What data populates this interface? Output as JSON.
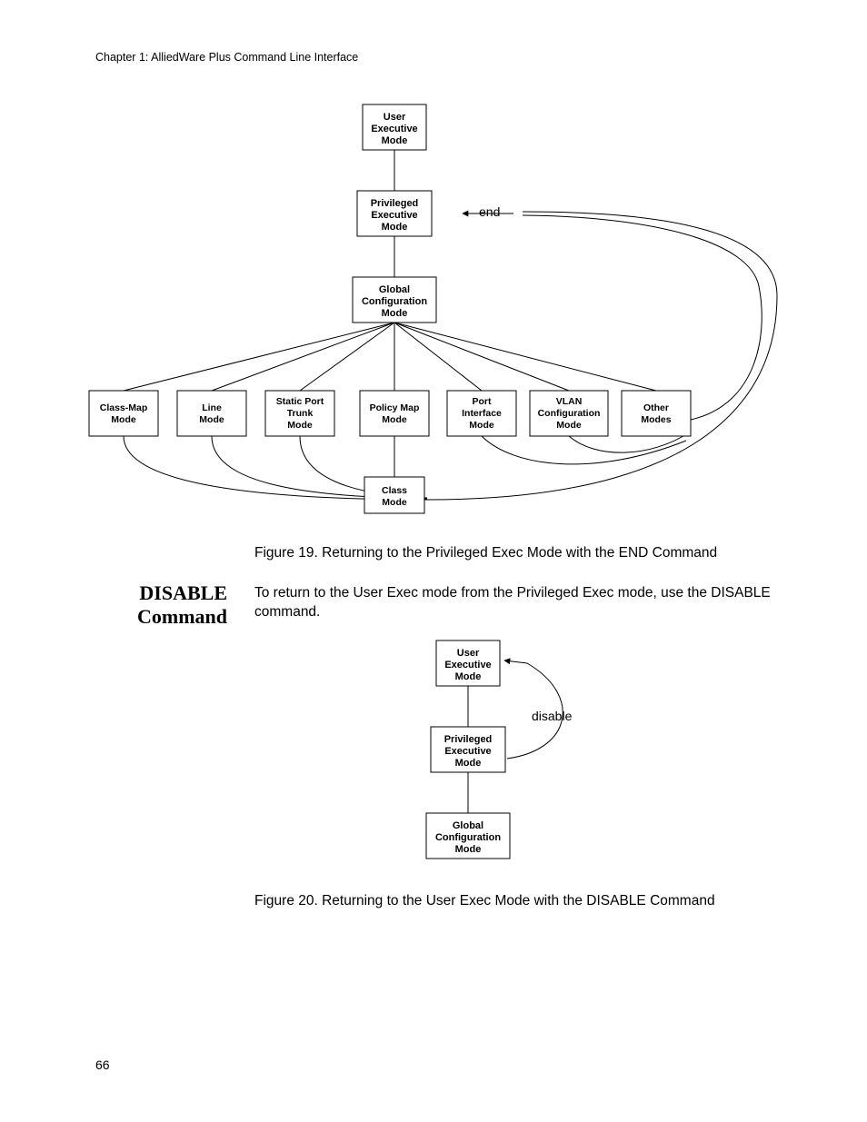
{
  "header": {
    "chapter": "Chapter 1: AlliedWare Plus Command Line Interface"
  },
  "page_number": "66",
  "figure19": {
    "caption": "Figure 19. Returning to the Privileged Exec Mode with the END Command",
    "nodes": {
      "user_exec": "User\nExecutive\nMode",
      "priv_exec": "Privileged\nExecutive\nMode",
      "global_conf": "Global\nConfiguration\nMode",
      "class_map": "Class-Map\nMode",
      "line_mode": "Line\nMode",
      "static_port": "Static Port\nTrunk\nMode",
      "policy_map": "Policy Map\nMode",
      "port_iface": "Port\nInterface\nMode",
      "vlan_conf": "VLAN\nConfiguration\nMode",
      "other_modes": "Other\nModes",
      "class_mode": "Class\nMode"
    },
    "end_label": "end"
  },
  "section": {
    "title_line1": "DISABLE",
    "title_line2": "Command",
    "body": "To return to the User Exec mode from the Privileged Exec mode, use the DISABLE command."
  },
  "figure20": {
    "caption": "Figure 20. Returning to the User Exec Mode with the DISABLE Command",
    "nodes": {
      "user_exec": "User\nExecutive\nMode",
      "priv_exec": "Privileged\nExecutive\nMode",
      "global_conf": "Global\nConfiguration\nMode"
    },
    "disable_label": "disable"
  },
  "chart_data": [
    {
      "type": "diagram",
      "title": "Figure 19. Returning to the Privileged Exec Mode with the END Command",
      "nodes": [
        {
          "id": "user_exec",
          "label": "User Executive Mode"
        },
        {
          "id": "priv_exec",
          "label": "Privileged Executive Mode"
        },
        {
          "id": "global_conf",
          "label": "Global Configuration Mode"
        },
        {
          "id": "class_map",
          "label": "Class-Map Mode"
        },
        {
          "id": "line_mode",
          "label": "Line Mode"
        },
        {
          "id": "static_port",
          "label": "Static Port Trunk Mode"
        },
        {
          "id": "policy_map",
          "label": "Policy Map Mode"
        },
        {
          "id": "port_iface",
          "label": "Port Interface Mode"
        },
        {
          "id": "vlan_conf",
          "label": "VLAN Configuration Mode"
        },
        {
          "id": "other_modes",
          "label": "Other Modes"
        },
        {
          "id": "class_mode",
          "label": "Class Mode"
        }
      ],
      "edges": [
        {
          "from": "user_exec",
          "to": "priv_exec",
          "type": "hierarchy"
        },
        {
          "from": "priv_exec",
          "to": "global_conf",
          "type": "hierarchy"
        },
        {
          "from": "global_conf",
          "to": "class_map",
          "type": "hierarchy"
        },
        {
          "from": "global_conf",
          "to": "line_mode",
          "type": "hierarchy"
        },
        {
          "from": "global_conf",
          "to": "static_port",
          "type": "hierarchy"
        },
        {
          "from": "global_conf",
          "to": "policy_map",
          "type": "hierarchy"
        },
        {
          "from": "global_conf",
          "to": "port_iface",
          "type": "hierarchy"
        },
        {
          "from": "global_conf",
          "to": "vlan_conf",
          "type": "hierarchy"
        },
        {
          "from": "global_conf",
          "to": "other_modes",
          "type": "hierarchy"
        },
        {
          "from": "policy_map",
          "to": "class_mode",
          "type": "hierarchy"
        },
        {
          "from": "global_conf",
          "to": "priv_exec",
          "type": "end",
          "label": "end"
        },
        {
          "from": "class_map",
          "to": "priv_exec",
          "type": "end"
        },
        {
          "from": "line_mode",
          "to": "priv_exec",
          "type": "end"
        },
        {
          "from": "static_port",
          "to": "priv_exec",
          "type": "end"
        },
        {
          "from": "policy_map",
          "to": "priv_exec",
          "type": "end"
        },
        {
          "from": "port_iface",
          "to": "priv_exec",
          "type": "end"
        },
        {
          "from": "vlan_conf",
          "to": "priv_exec",
          "type": "end"
        },
        {
          "from": "other_modes",
          "to": "priv_exec",
          "type": "end"
        },
        {
          "from": "class_mode",
          "to": "priv_exec",
          "type": "end"
        }
      ]
    },
    {
      "type": "diagram",
      "title": "Figure 20. Returning to the User Exec Mode with the DISABLE Command",
      "nodes": [
        {
          "id": "user_exec",
          "label": "User Executive Mode"
        },
        {
          "id": "priv_exec",
          "label": "Privileged Executive Mode"
        },
        {
          "id": "global_conf",
          "label": "Global Configuration Mode"
        }
      ],
      "edges": [
        {
          "from": "user_exec",
          "to": "priv_exec",
          "type": "hierarchy"
        },
        {
          "from": "priv_exec",
          "to": "global_conf",
          "type": "hierarchy"
        },
        {
          "from": "priv_exec",
          "to": "user_exec",
          "type": "disable",
          "label": "disable"
        }
      ]
    }
  ]
}
